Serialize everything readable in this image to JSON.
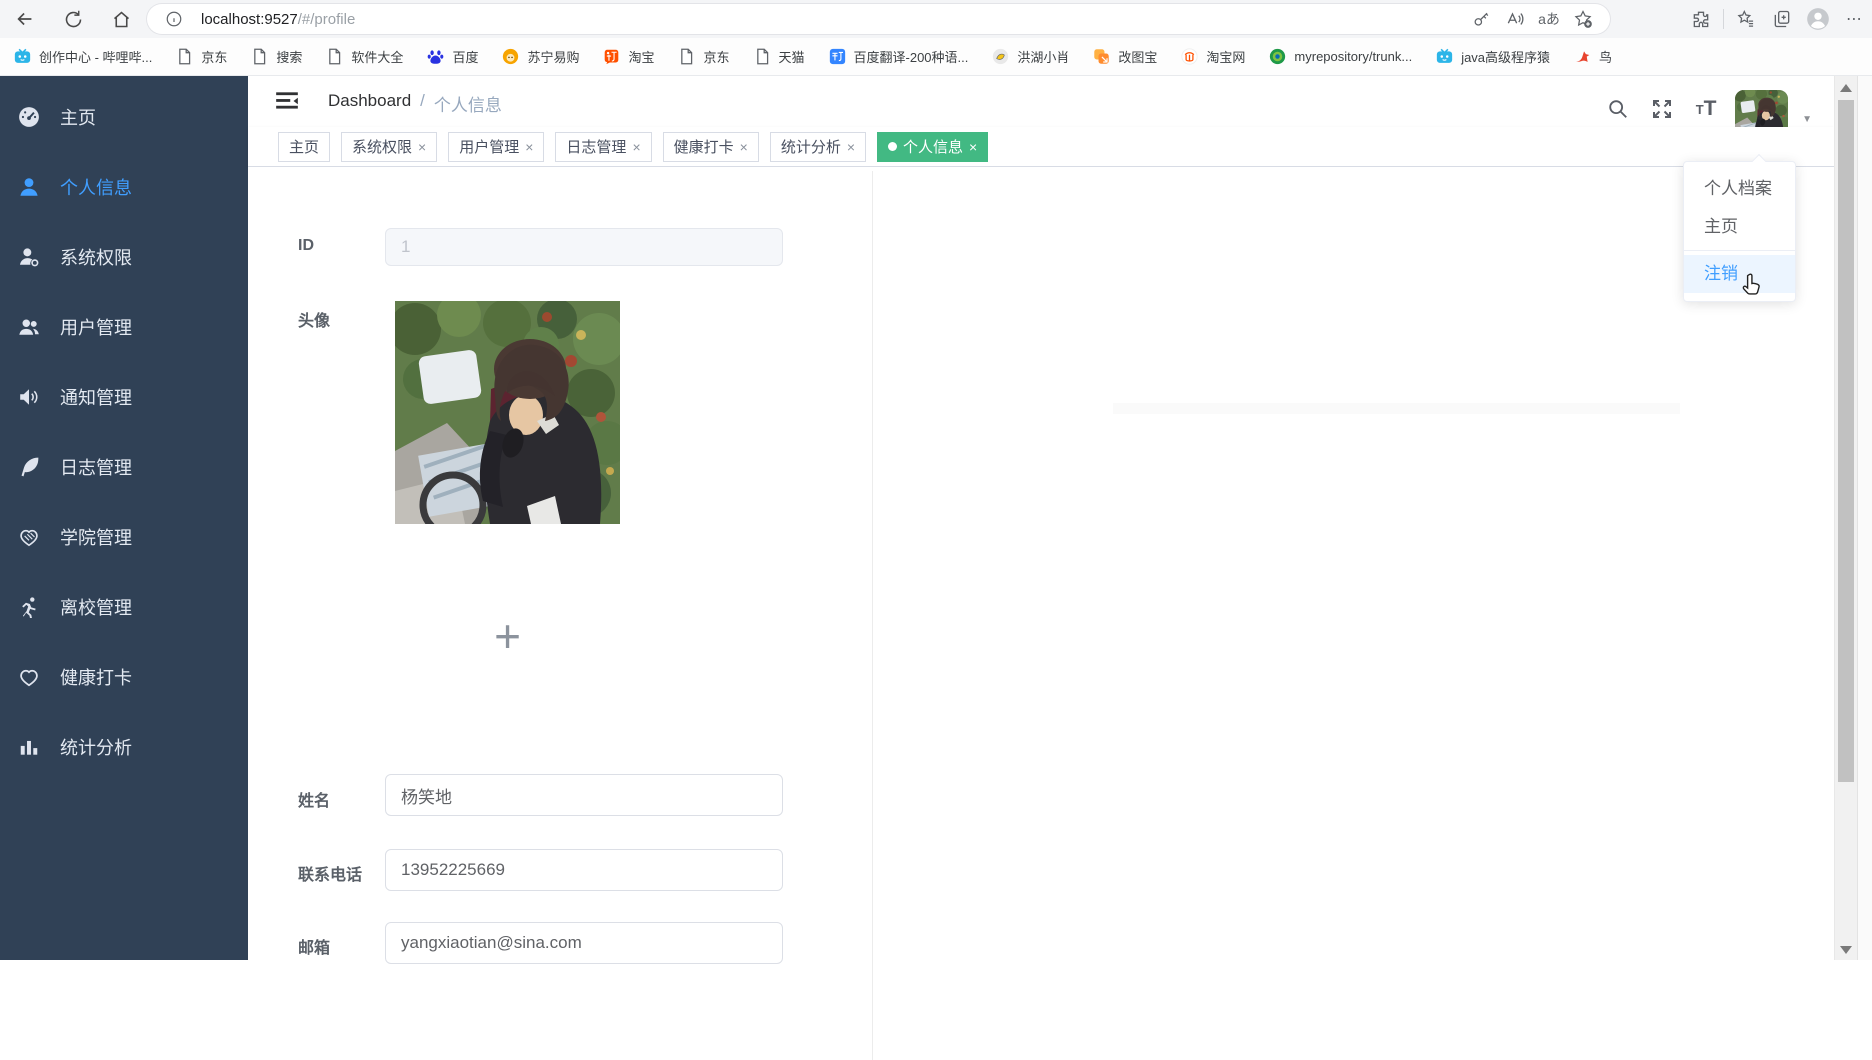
{
  "browser": {
    "url_host": "localhost:9527",
    "url_path": "/#/profile",
    "toolbar": {
      "translate_glyph": "aあ",
      "more_glyph": "⋯"
    }
  },
  "bookmarks": {
    "items": [
      {
        "icon": "bilibili-icon",
        "label": "创作中心 - 哔哩哔..."
      },
      {
        "icon": "page-icon",
        "label": "京东"
      },
      {
        "icon": "page-icon",
        "label": "搜索"
      },
      {
        "icon": "page-icon",
        "label": "软件大全"
      },
      {
        "icon": "baidu-icon",
        "label": "百度"
      },
      {
        "icon": "suning-icon",
        "label": "苏宁易购"
      },
      {
        "icon": "taobao-icon",
        "label": "淘宝"
      },
      {
        "icon": "page-icon",
        "label": "京东"
      },
      {
        "icon": "page-icon",
        "label": "天猫"
      },
      {
        "icon": "translate-icon",
        "label": "百度翻译-200种语..."
      },
      {
        "icon": "honghu-icon",
        "label": "洪湖小肖"
      },
      {
        "icon": "gaitubao-icon",
        "label": "改图宝"
      },
      {
        "icon": "taobao-shop-icon",
        "label": "淘宝网"
      },
      {
        "icon": "repo-icon",
        "label": "myrepository/trunk..."
      },
      {
        "icon": "bilibili-icon",
        "label": "java高级程序猿"
      },
      {
        "icon": "bird-icon",
        "label": "鸟"
      }
    ]
  },
  "sidebar": {
    "items": [
      {
        "icon": "dashboard-icon",
        "label": "主页",
        "active": false
      },
      {
        "icon": "user-icon",
        "label": "个人信息",
        "active": true
      },
      {
        "icon": "permission-icon",
        "label": "系统权限",
        "active": false
      },
      {
        "icon": "users-icon",
        "label": "用户管理",
        "active": false
      },
      {
        "icon": "speaker-icon",
        "label": "通知管理",
        "active": false
      },
      {
        "icon": "quill-icon",
        "label": "日志管理",
        "active": false
      },
      {
        "icon": "college-icon",
        "label": "学院管理",
        "active": false
      },
      {
        "icon": "runner-icon",
        "label": "离校管理",
        "active": false
      },
      {
        "icon": "heart-icon",
        "label": "健康打卡",
        "active": false
      },
      {
        "icon": "chart-icon",
        "label": "统计分析",
        "active": false
      }
    ]
  },
  "navbar": {
    "breadcrumb": {
      "root": "Dashboard",
      "separator": "/",
      "current": "个人信息"
    },
    "font_icon": {
      "big": "T",
      "small": "T"
    },
    "caret_glyph": "▼"
  },
  "tags": {
    "close_glyph": "×",
    "items": [
      {
        "label": "主页",
        "closable": false,
        "active": false
      },
      {
        "label": "系统权限",
        "closable": true,
        "active": false
      },
      {
        "label": "用户管理",
        "closable": true,
        "active": false
      },
      {
        "label": "日志管理",
        "closable": true,
        "active": false
      },
      {
        "label": "健康打卡",
        "closable": true,
        "active": false
      },
      {
        "label": "统计分析",
        "closable": true,
        "active": false
      },
      {
        "label": "个人信息",
        "closable": true,
        "active": true
      }
    ]
  },
  "dropdown": {
    "items": [
      {
        "label": "个人档案",
        "hover": false
      },
      {
        "label": "主页",
        "hover": false
      },
      {
        "label": "注销",
        "hover": true
      }
    ]
  },
  "form": {
    "fields": [
      {
        "label": "ID",
        "value": "1",
        "disabled": true
      },
      {
        "label": "头像"
      },
      {
        "label": "姓名",
        "value": "杨笑地"
      },
      {
        "label": "联系电话",
        "value": "13952225669"
      },
      {
        "label": "邮箱",
        "value": "yangxiaotian@sina.com"
      }
    ],
    "upload_glyph": "+"
  },
  "colors": {
    "sidebar_bg": "#304156",
    "accent_blue": "#409EFF",
    "active_tag_green": "#42b983",
    "bilibili_blue": "#2cb5e8",
    "taobao_orange": "#ff5000"
  }
}
